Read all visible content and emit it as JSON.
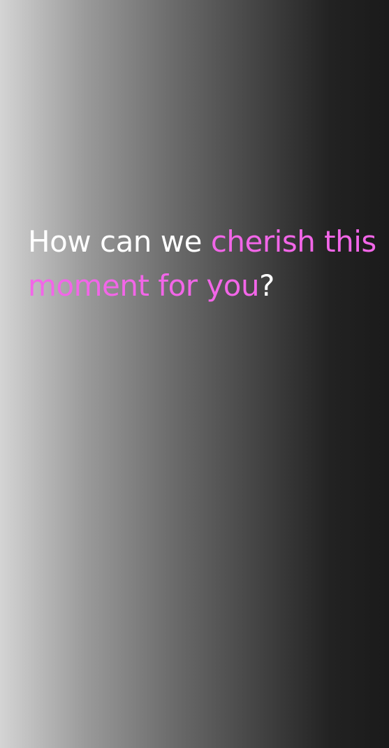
{
  "headline": {
    "part1": "How can we ",
    "highlight": "cherish this moment for you",
    "part2": "?"
  },
  "colors": {
    "text": "#ffffff",
    "accent": "#f266e8",
    "gradient_start": "#d4d4d4",
    "gradient_end": "#1a1a1a"
  }
}
